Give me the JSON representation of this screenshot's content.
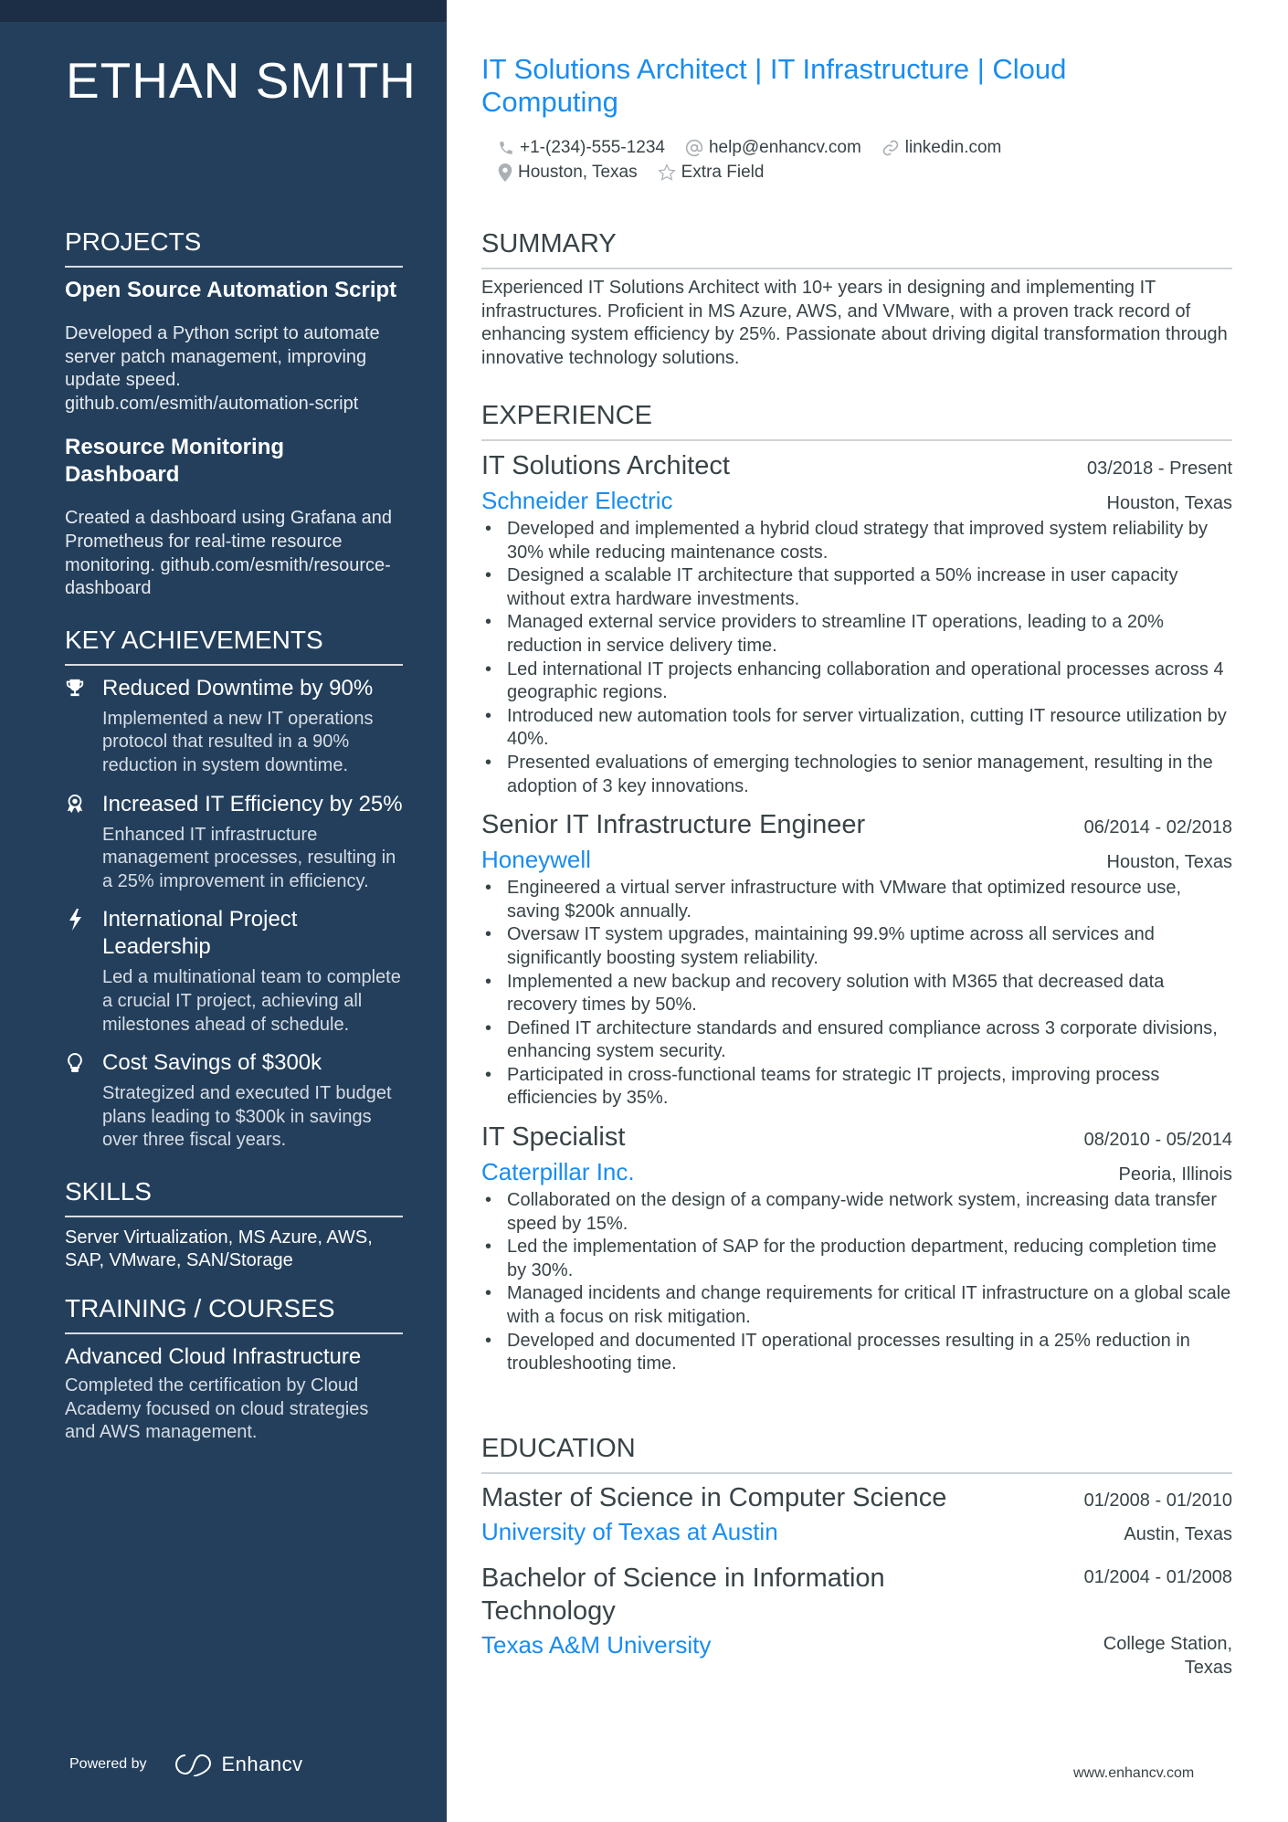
{
  "name": "ETHAN SMITH",
  "headline": "IT Solutions Architect | IT Infrastructure | Cloud Computing",
  "contacts": {
    "phone": "+1-(234)-555-1234",
    "email": "help@enhancv.com",
    "link": "linkedin.com",
    "location": "Houston, Texas",
    "extra": "Extra Field"
  },
  "colors": {
    "sidebar": "#233f5c",
    "topbar": "#1b2e45",
    "accent": "#1a8cf0",
    "text": "#384347"
  },
  "sidebar": {
    "projects": {
      "heading": "PROJECTS",
      "items": [
        {
          "title": "Open Source Automation Script",
          "description": "Developed a Python script to automate server patch management, improving update speed. github.com/esmith/automation-script"
        },
        {
          "title": "Resource Monitoring Dashboard",
          "description": "Created a dashboard using Grafana and Prometheus for real-time resource monitoring. github.com/esmith/resource-dashboard"
        }
      ]
    },
    "achievements": {
      "heading": "KEY ACHIEVEMENTS",
      "items": [
        {
          "icon": "trophy-icon",
          "title": "Reduced Downtime by 90%",
          "description": "Implemented a new IT operations protocol that resulted in a 90% reduction in system downtime."
        },
        {
          "icon": "award-ribbon-icon",
          "title": "Increased IT Efficiency by 25%",
          "description": "Enhanced IT infrastructure management processes, resulting in a 25% improvement in efficiency."
        },
        {
          "icon": "lightning-bolt-icon",
          "title": "International Project Leadership",
          "description": "Led a multinational team to complete a crucial IT project, achieving all milestones ahead of schedule."
        },
        {
          "icon": "lightbulb-icon",
          "title": "Cost Savings of $300k",
          "description": "Strategized and executed IT budget plans leading to $300k in savings over three fiscal years."
        }
      ]
    },
    "skills": {
      "heading": "SKILLS",
      "text": "Server Virtualization, MS Azure, AWS, SAP, VMware, SAN/Storage"
    },
    "training": {
      "heading": "TRAINING / COURSES",
      "items": [
        {
          "title": "Advanced Cloud Infrastructure",
          "description": "Completed the certification by Cloud Academy focused on cloud strategies and AWS management."
        }
      ]
    },
    "powered_by": "Powered by",
    "brand": "Enhancv"
  },
  "summary": {
    "heading": "SUMMARY",
    "text": "Experienced IT Solutions Architect with 10+ years in designing and implementing IT infrastructures. Proficient in MS Azure, AWS, and VMware, with a proven track record of enhancing system efficiency by 25%. Passionate about driving digital transformation through innovative technology solutions."
  },
  "experience": {
    "heading": "EXPERIENCE",
    "jobs": [
      {
        "title": "IT Solutions Architect",
        "dates": "03/2018 - Present",
        "company": "Schneider Electric",
        "location": "Houston, Texas",
        "bullets": [
          "Developed and implemented a hybrid cloud strategy that improved system reliability by 30% while reducing maintenance costs.",
          "Designed a scalable IT architecture that supported a 50% increase in user capacity without extra hardware investments.",
          "Managed external service providers to streamline IT operations, leading to a 20% reduction in service delivery time.",
          "Led international IT projects enhancing collaboration and operational processes across 4 geographic regions.",
          "Introduced new automation tools for server virtualization, cutting IT resource utilization by 40%.",
          "Presented evaluations of emerging technologies to senior management, resulting in the adoption of 3 key innovations."
        ]
      },
      {
        "title": "Senior IT Infrastructure Engineer",
        "dates": "06/2014 - 02/2018",
        "company": "Honeywell",
        "location": "Houston, Texas",
        "bullets": [
          "Engineered a virtual server infrastructure with VMware that optimized resource use, saving $200k annually.",
          "Oversaw IT system upgrades, maintaining 99.9% uptime across all services and significantly boosting system reliability.",
          "Implemented a new backup and recovery solution with M365 that decreased data recovery times by 50%.",
          "Defined IT architecture standards and ensured compliance across 3 corporate divisions, enhancing system security.",
          "Participated in cross-functional teams for strategic IT projects, improving process efficiencies by 35%."
        ]
      },
      {
        "title": "IT Specialist",
        "dates": "08/2010 - 05/2014",
        "company": "Caterpillar Inc.",
        "location": "Peoria, Illinois",
        "bullets": [
          "Collaborated on the design of a company-wide network system, increasing data transfer speed by 15%.",
          "Led the implementation of SAP for the production department, reducing completion time by 30%.",
          "Managed incidents and change requirements for critical IT infrastructure on a global scale with a focus on risk mitigation.",
          "Developed and documented IT operational processes resulting in a 25% reduction in troubleshooting time."
        ]
      }
    ]
  },
  "education": {
    "heading": "EDUCATION",
    "items": [
      {
        "degree": "Master of Science in Computer Science",
        "dates": "01/2008 - 01/2010",
        "school": "University of Texas at Austin",
        "location": "Austin, Texas"
      },
      {
        "degree": "Bachelor of Science in Information Technology",
        "dates": "01/2004 - 01/2008",
        "school": "Texas A&M University",
        "location": "College Station, Texas"
      }
    ]
  },
  "footer_url": "www.enhancv.com"
}
